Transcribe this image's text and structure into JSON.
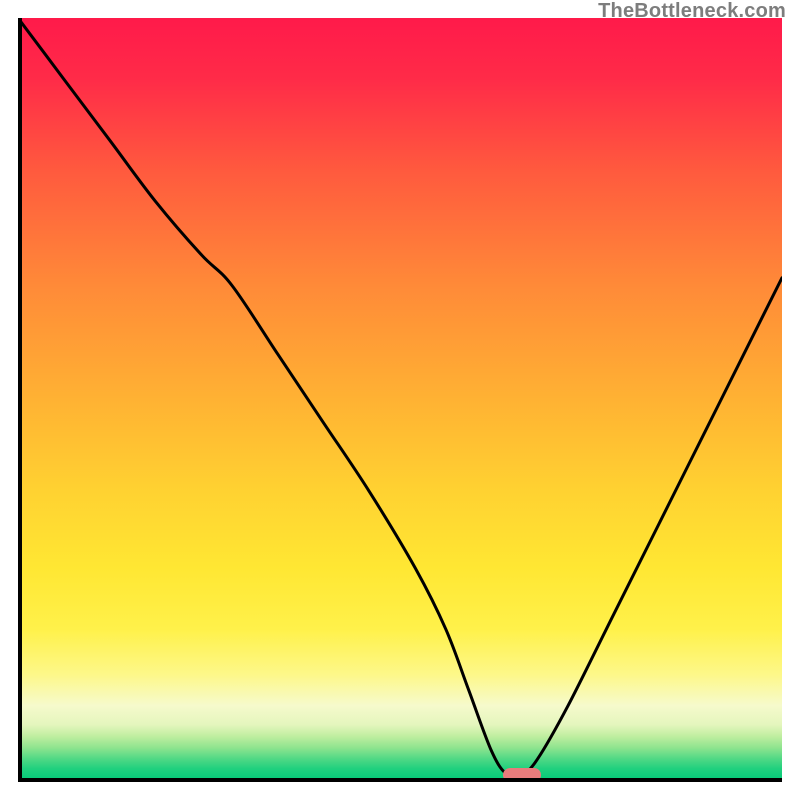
{
  "watermark": "TheBottleneck.com",
  "marker": {
    "x_pct": 63.5,
    "width_pct": 5.0
  },
  "chart_data": {
    "type": "line",
    "title": "",
    "xlabel": "",
    "ylabel": "",
    "xlim": [
      0,
      100
    ],
    "ylim": [
      0,
      100
    ],
    "grid": false,
    "legend": false,
    "background": "red-yellow-green vertical gradient (red top, green bottom)",
    "series": [
      {
        "name": "bottleneck-curve",
        "x": [
          0,
          6,
          12,
          18,
          24,
          28,
          34,
          40,
          46,
          52,
          56,
          59,
          62,
          64,
          66,
          68,
          72,
          78,
          84,
          90,
          96,
          100
        ],
        "y": [
          100,
          92,
          84,
          76,
          69,
          65,
          56,
          47,
          38,
          28,
          20,
          12,
          4,
          1,
          1,
          3,
          10,
          22,
          34,
          46,
          58,
          66
        ]
      }
    ],
    "annotations": [
      {
        "type": "pill-marker",
        "x_center_pct": 66,
        "y_pct": 0.6,
        "color": "#e87c7c"
      }
    ]
  }
}
